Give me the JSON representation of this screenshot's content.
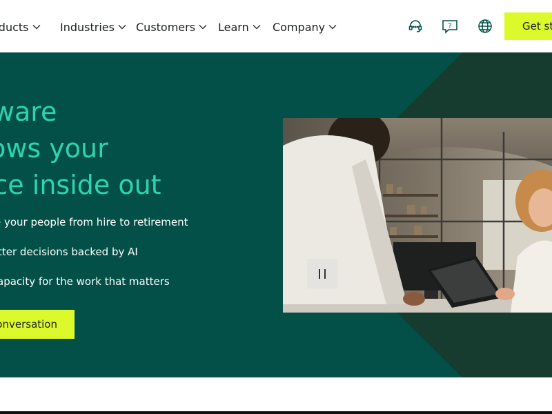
{
  "nav": {
    "items": [
      {
        "label": "oducts"
      },
      {
        "label": "Industries"
      },
      {
        "label": "Customers"
      },
      {
        "label": "Learn"
      },
      {
        "label": "Company"
      }
    ],
    "icons": [
      "headset-icon",
      "help-chat-icon",
      "globe-icon"
    ],
    "cta_label": "Get sta"
  },
  "hero": {
    "headline_lines": [
      "oftware",
      "knows your",
      "force inside out"
    ],
    "benefits": [
      "e your people from hire to retirement",
      "tter decisions backed by AI",
      "apacity for the work that matters"
    ],
    "cta_label": "conversation"
  },
  "colors": {
    "hero_bg": "#035049",
    "hero_dark_shape": "#163c30",
    "headline": "#2ed3b0",
    "accent": "#dcfa2b",
    "icon_teal": "#035049"
  }
}
